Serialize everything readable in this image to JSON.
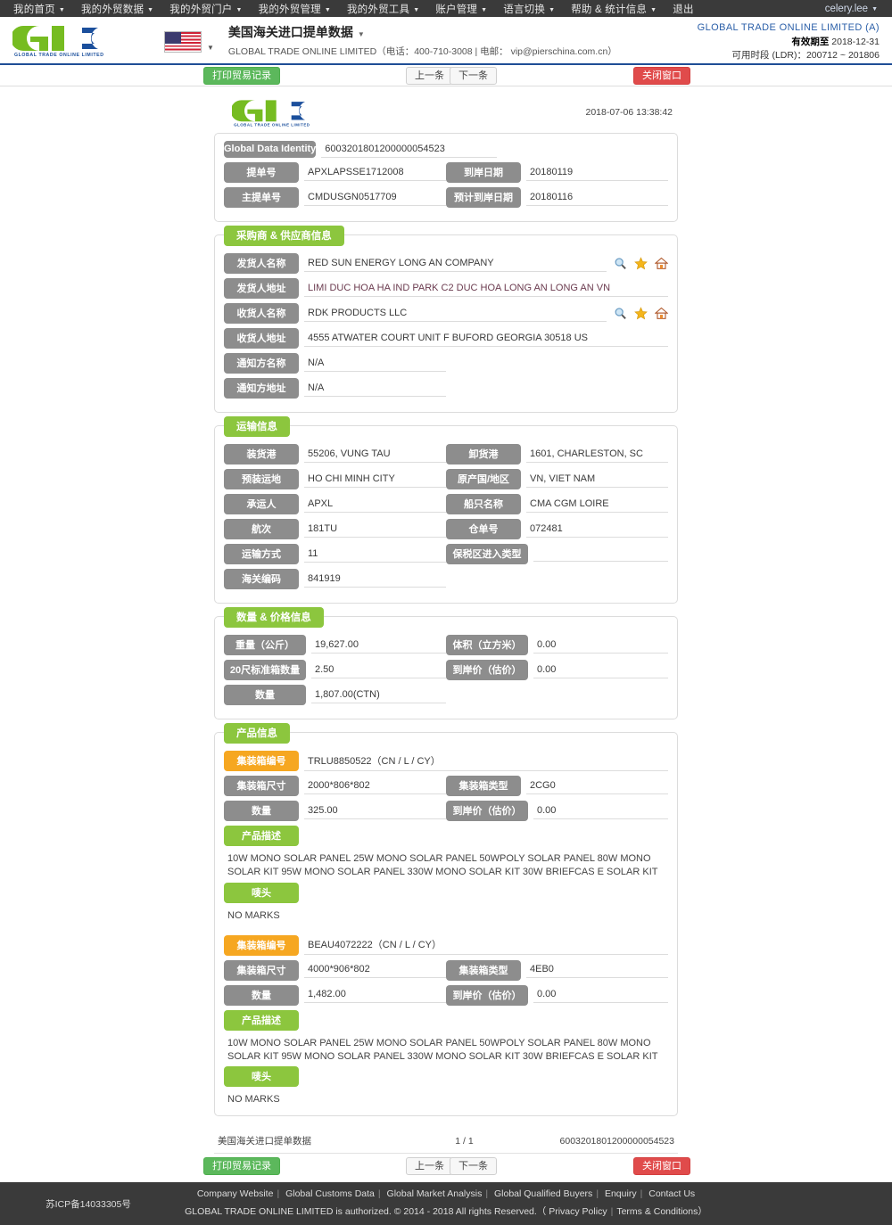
{
  "topnav": {
    "items": [
      {
        "label": "我的首页",
        "caret": true
      },
      {
        "label": "我的外贸数据",
        "caret": true
      },
      {
        "label": "我的外贸门户",
        "caret": true
      },
      {
        "label": "我的外贸管理",
        "caret": true
      },
      {
        "label": "我的外贸工具",
        "caret": true
      },
      {
        "label": "账户管理",
        "caret": true
      },
      {
        "label": "语言切换",
        "caret": true
      },
      {
        "label": "帮助 & 统计信息",
        "caret": true
      },
      {
        "label": "退出",
        "caret": false
      }
    ],
    "user": "celery.lee"
  },
  "header": {
    "logo_text": "GLOBAL TRADE ONLINE LIMITED",
    "flag": "us-flag-icon",
    "title": "美国海关进口提单数据",
    "subtitle": "GLOBAL TRADE ONLINE LIMITED（电话：400-710-3008 | 电邮： vip@pierschina.com.cn）",
    "company": "GLOBAL TRADE ONLINE LIMITED (A)",
    "valid_label": "有效期至",
    "valid_value": "2018-12-31",
    "ldr": "可用时段 (LDR)：200712 ~ 201806",
    "accent": "#1f4e96"
  },
  "toolbar": {
    "print_label": "打印贸易记录",
    "prev_label": "上一条",
    "next_label": "下一条",
    "close_label": "关闭窗口"
  },
  "document": {
    "timestamp": "2018-07-06 13:38:42",
    "identity": {
      "label": "Global Data Identity",
      "value": "6003201801200000054523"
    },
    "bill_rows": [
      {
        "label": "提单号",
        "value": "APXLAPSSE1712008",
        "label2": "到岸日期",
        "value2": "20180119"
      },
      {
        "label": "主提单号",
        "value": "CMDUSGN0517709",
        "label2": "预计到岸日期",
        "value2": "20180116"
      }
    ],
    "parties": {
      "title": "采购商 & 供应商信息",
      "rows": [
        {
          "label": "发货人名称",
          "value": "RED SUN ENERGY LONG AN COMPANY",
          "icons": true
        },
        {
          "label": "发货人地址",
          "value": "LIMI DUC HOA HA IND PARK C2 DUC HOA LONG AN LONG AN VN",
          "icons": false
        },
        {
          "label": "收货人名称",
          "value": "RDK PRODUCTS LLC",
          "icons": true
        },
        {
          "label": "收货人地址",
          "value": "4555 ATWATER COURT UNIT F BUFORD GEORGIA 30518 US",
          "icons": false
        },
        {
          "label": "通知方名称",
          "value": "N/A",
          "icons": false
        },
        {
          "label": "通知方地址",
          "value": "N/A",
          "icons": false
        }
      ]
    },
    "transport": {
      "title": "运输信息",
      "rows": [
        {
          "label": "装货港",
          "value": "55206, VUNG TAU",
          "label2": "卸货港",
          "value2": "1601, CHARLESTON, SC"
        },
        {
          "label": "预装运地",
          "value": "HO CHI MINH CITY",
          "label2": "原产国/地区",
          "value2": "VN, VIET NAM"
        },
        {
          "label": "承运人",
          "value": "APXL",
          "label2": "船只名称",
          "value2": "CMA CGM LOIRE"
        },
        {
          "label": "航次",
          "value": "181TU",
          "label2": "仓单号",
          "value2": "072481"
        },
        {
          "label": "运输方式",
          "value": "11",
          "label2": "保税区进入类型",
          "value2": ""
        },
        {
          "label": "海关编码",
          "value": "841919",
          "label2": "",
          "value2": ""
        }
      ]
    },
    "quantity": {
      "title": "数量 & 价格信息",
      "rows": [
        {
          "label": "重量（公斤）",
          "value": "19,627.00",
          "label2": "体积（立方米）",
          "value2": "0.00"
        },
        {
          "label": "20尺标准箱数量",
          "value": "2.50",
          "label2": "到岸价（估价）",
          "value2": "0.00"
        },
        {
          "label": "数量",
          "value": "1,807.00(CTN)",
          "label2": "",
          "value2": ""
        }
      ]
    },
    "products": {
      "title": "产品信息",
      "labels": {
        "container_no": "集装箱编号",
        "container_size": "集装箱尺寸",
        "container_type": "集装箱类型",
        "quantity": "数量",
        "cif": "到岸价（估价）",
        "description": "产品描述",
        "marks": "唛头"
      },
      "items": [
        {
          "container_no": "TRLU8850522（CN / L / CY）",
          "container_size": "2000*806*802",
          "container_type": "2CG0",
          "quantity": "325.00",
          "cif": "0.00",
          "description": "10W MONO SOLAR PANEL 25W MONO SOLAR PANEL 50WPOLY SOLAR PANEL 80W MONO SOLAR KIT 95W MONO SOLAR PANEL 330W MONO SOLAR KIT 30W BRIEFCAS E SOLAR KIT",
          "marks": "NO MARKS"
        },
        {
          "container_no": "BEAU4072222（CN / L / CY）",
          "container_size": "4000*906*802",
          "container_type": "4EB0",
          "quantity": "1,482.00",
          "cif": "0.00",
          "description": "10W MONO SOLAR PANEL 25W MONO SOLAR PANEL 50WPOLY SOLAR PANEL 80W MONO SOLAR KIT 95W MONO SOLAR PANEL 330W MONO SOLAR KIT 30W BRIEFCAS E SOLAR KIT",
          "marks": "NO MARKS"
        }
      ]
    },
    "footer": {
      "left": "美国海关进口提单数据",
      "center": "1 / 1",
      "right": "6003201801200000054523"
    }
  },
  "footer": {
    "icp": "苏ICP备14033305号",
    "links": [
      "Company Website",
      "Global Customs Data",
      "Global Market Analysis",
      "Global Qualified Buyers",
      "Enquiry",
      "Contact Us"
    ],
    "copyright_pre": "GLOBAL TRADE ONLINE LIMITED is authorized. © 2014 - 2018 All rights Reserved.（",
    "privacy": "Privacy Policy",
    "terms": "Terms & Conditions",
    "copyright_post": "）"
  }
}
